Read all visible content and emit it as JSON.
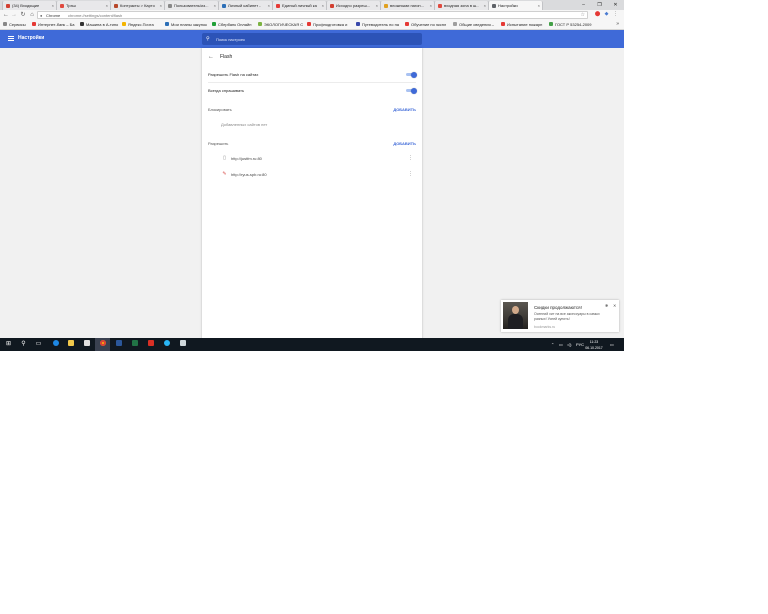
{
  "browser": {
    "tabs": [
      {
        "title": "(34) Входящие",
        "favicon_color": "#d23f31"
      },
      {
        "title": "Трэш",
        "favicon_color": "#e04a3f"
      },
      {
        "title": "Контракты > Карто...",
        "favicon_color": "#b7472a"
      },
      {
        "title": "Пользователь/из...",
        "favicon_color": "#888888"
      },
      {
        "title": "Личный кабинет -",
        "favicon_color": "#2c6fb7"
      },
      {
        "title": "Единый личный ка...",
        "favicon_color": "#e53935"
      },
      {
        "title": "Исходно разреш...",
        "favicon_color": "#d23f31"
      },
      {
        "title": "вложными пагон...",
        "favicon_color": "#e0a020"
      },
      {
        "title": "входная зона в ш...",
        "favicon_color": "#e04a3f"
      },
      {
        "title": "Настройки",
        "favicon_color": "#5f6368"
      }
    ],
    "omnibox_site": "Chrome",
    "omnibox_url": "chrome://settings/content/flash",
    "bookmarks": [
      {
        "label": "Сервисы",
        "color": "#888888"
      },
      {
        "label": "Интернет-банк – Ба",
        "color": "#e53935"
      },
      {
        "label": "Машина в А-типо",
        "color": "#333333"
      },
      {
        "label": "Яндекс.Почта",
        "color": "#f4b400"
      },
      {
        "label": "Мои планы закупок",
        "color": "#2c6fb7"
      },
      {
        "label": "Сбербанк Онлайн",
        "color": "#21a038"
      },
      {
        "label": "ЭКОЛОГИЧЕСКАЯ С",
        "color": "#7cb342"
      },
      {
        "label": "Профподготовка и",
        "color": "#e53935"
      },
      {
        "label": "Путеводитель по на",
        "color": "#3949ab"
      },
      {
        "label": "Обучение по экспл",
        "color": "#e53935"
      },
      {
        "label": "Общие сведения – ",
        "color": "#9e9e9e"
      },
      {
        "label": "Испытание пожарн",
        "color": "#e53935"
      },
      {
        "label": "ГОСТ Р 53254-2009",
        "color": "#43a047"
      }
    ]
  },
  "settings": {
    "header_title": "Настройки",
    "search_placeholder": "Поиск настроек",
    "accent_color": "#3f6ad8",
    "page_title": "Flash",
    "toggles": [
      {
        "label": "Разрешить Flash на сайтах",
        "on": true
      },
      {
        "label": "Всегда спрашивать",
        "on": true
      }
    ],
    "block_section": {
      "label": "Блокировать",
      "add_label": "ДОБАВИТЬ",
      "empty_text": "Добавленных сайтов нет"
    },
    "allow_section": {
      "label": "Разрешить",
      "add_label": "ДОБАВИТЬ",
      "sites": [
        {
          "url": "http://justfm.ru:80",
          "icon": "page-icon"
        },
        {
          "url": "http://ryus-spb.ru:80",
          "icon": "plugin-blocked-icon"
        }
      ]
    }
  },
  "notification": {
    "title": "Скидки продолжаются!",
    "body": "Осенний хит на все аксессуары в самых разных! Успей купить!",
    "source": "bookmarks.ru"
  },
  "taskbar": {
    "lang": "РУС",
    "time": "11:23",
    "date": "06.10.2017"
  }
}
